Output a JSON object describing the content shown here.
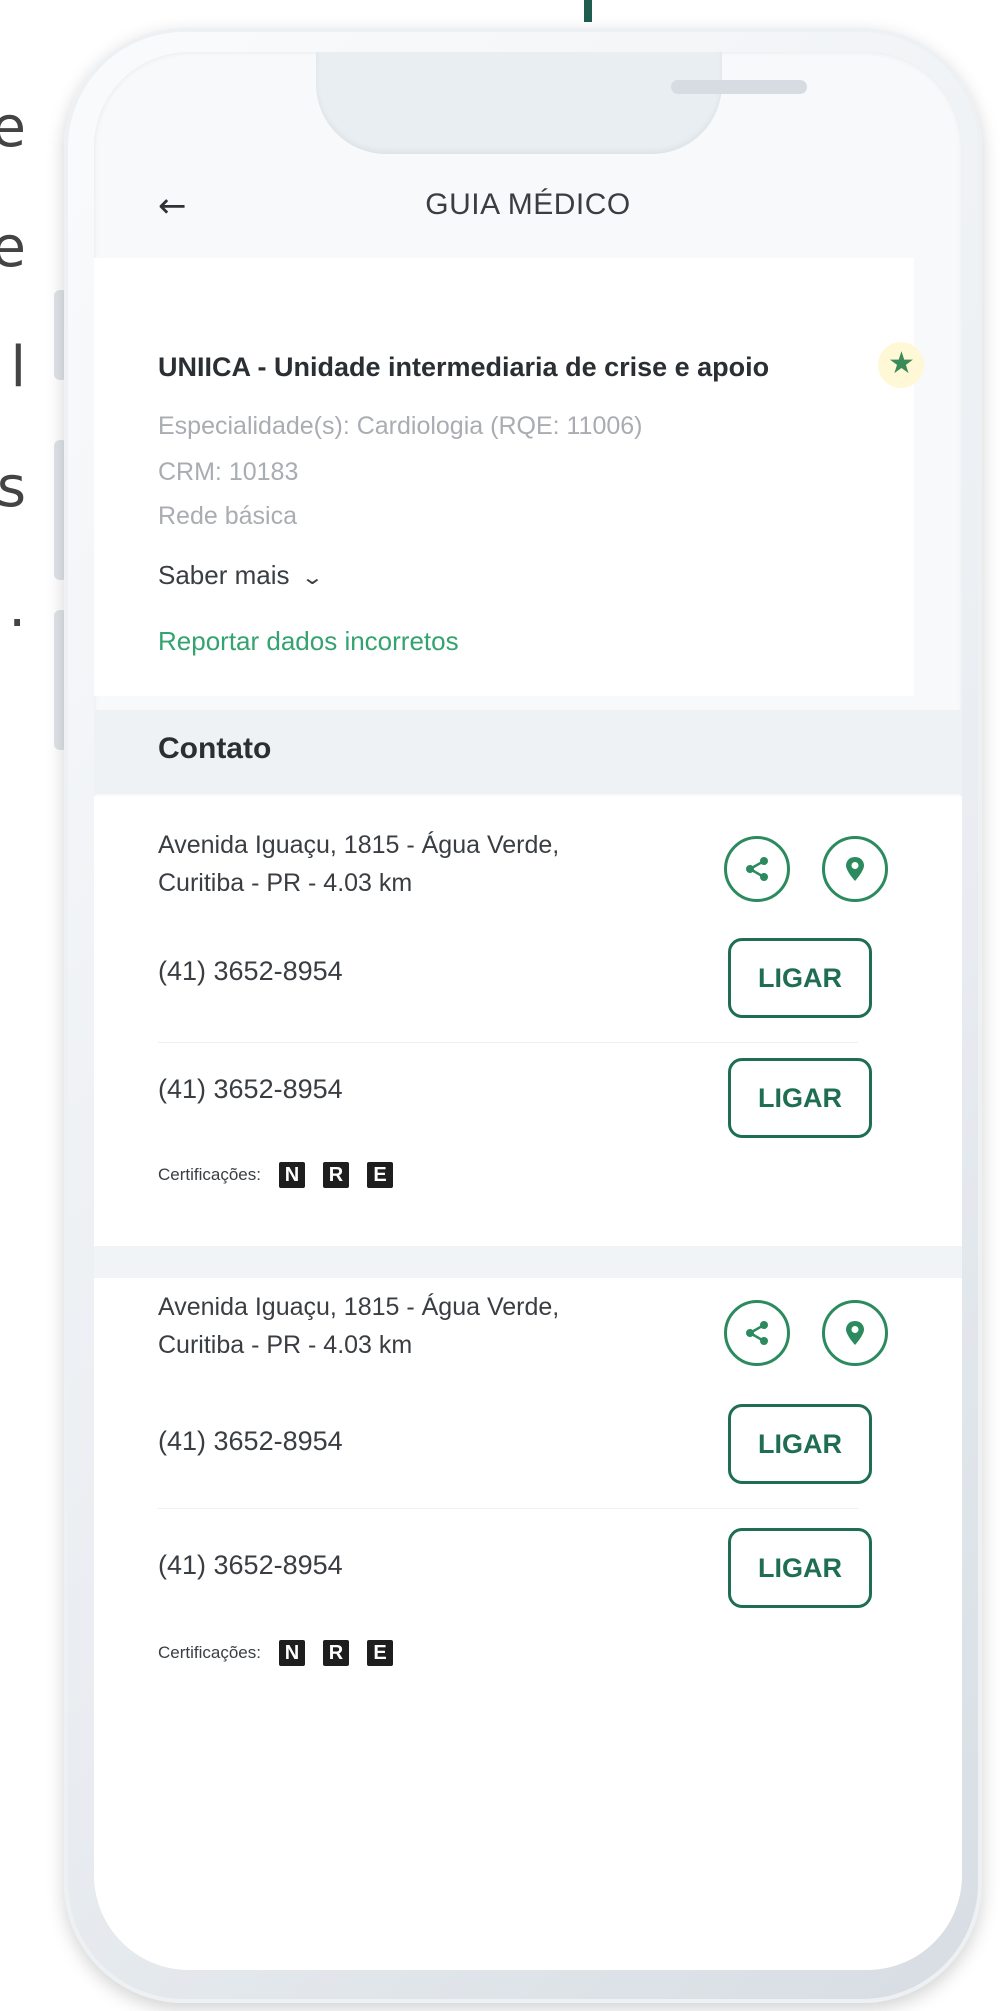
{
  "left_edge_glyphs": [
    "e",
    "e",
    "l",
    "s",
    "."
  ],
  "header": {
    "title": "GUIA MÉDICO"
  },
  "provider": {
    "name": "UNIICA - Unidade intermediaria de crise e apoio",
    "specialty": "Especialidade(s): Cardiologia (RQE: 11006)",
    "crm": "CRM: 10183",
    "network": "Rede básica",
    "more_label": "Saber mais",
    "report_label": "Reportar dados incorretos"
  },
  "contact": {
    "title": "Contato",
    "blocks": [
      {
        "address_line1": "Avenida Iguaçu, 1815 - Água Verde,",
        "address_line2": "Curitiba - PR - 4.03 km",
        "phones": [
          "(41) 3652-8954",
          "(41) 3652-8954"
        ],
        "call_label": "LIGAR",
        "certifications_label": "Certificações:",
        "badges": [
          "N",
          "R",
          "E"
        ]
      },
      {
        "address_line1": "Avenida Iguaçu, 1815 - Água Verde,",
        "address_line2": "Curitiba - PR - 4.03 km",
        "phones": [
          "(41) 3652-8954",
          "(41) 3652-8954"
        ],
        "call_label": "LIGAR",
        "certifications_label": "Certificações:",
        "badges": [
          "N",
          "R",
          "E"
        ]
      }
    ]
  },
  "colors": {
    "accent": "#1f6e52",
    "link": "#33a370",
    "favorite": "#3a8b57"
  },
  "icons": {
    "back": "arrow-left-icon",
    "share": "share-icon",
    "map": "map-pin-icon",
    "favorite": "star-icon",
    "more": "chevron-down-icon"
  }
}
